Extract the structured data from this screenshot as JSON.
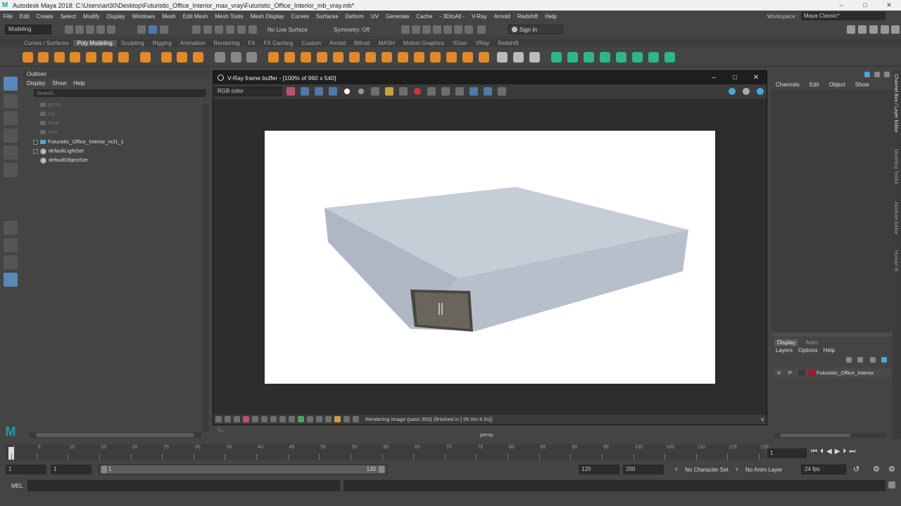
{
  "app": {
    "title": "Autodesk Maya 2018: C:\\Users\\art30\\Desktop\\Futuristic_Office_Interior_max_vray\\Futuristic_Office_Interior_mb_vray.mb*",
    "logo": "M"
  },
  "menu": [
    "File",
    "Edit",
    "Create",
    "Select",
    "Modify",
    "Display",
    "Windows",
    "Mesh",
    "Edit Mesh",
    "Mesh Tools",
    "Mesh Display",
    "Curves",
    "Surfaces",
    "Deform",
    "UV",
    "Generate",
    "Cache",
    "- 3DtoAll -",
    "V-Ray",
    "Arnold",
    "Redshift",
    "Help"
  ],
  "workspace": {
    "label": "Workspace :",
    "value": "Maya Classic*"
  },
  "statusline": {
    "mode": "Modeling",
    "live_surface": "No Live Surface",
    "symmetry": "Symmetry: Off",
    "sign_in": "Sign In"
  },
  "shelf_tabs": [
    "Curves / Surfaces",
    "Poly Modeling",
    "Sculpting",
    "Rigging",
    "Animation",
    "Rendering",
    "FX",
    "FX Caching",
    "Custom",
    "Arnold",
    "Bifrost",
    "MASH",
    "Motion Graphics",
    "XGen",
    "VRay",
    "Redshift"
  ],
  "shelf_active": "Poly Modeling",
  "outliner": {
    "title": "Outliner",
    "menu": [
      "Display",
      "Show",
      "Help"
    ],
    "search_placeholder": "Search...",
    "items": [
      {
        "label": "persp",
        "dim": true,
        "icon": "camera-icon"
      },
      {
        "label": "top",
        "dim": true,
        "icon": "camera-icon"
      },
      {
        "label": "front",
        "dim": true,
        "icon": "camera-icon"
      },
      {
        "label": "side",
        "dim": true,
        "icon": "camera-icon"
      },
      {
        "label": "Futuristic_Office_Interior_ncl1_1",
        "dim": false,
        "icon": "group-icon"
      },
      {
        "label": "defaultLightSet",
        "dim": false,
        "icon": "set-icon"
      },
      {
        "label": "defaultObjectSet",
        "dim": false,
        "icon": "set-icon"
      }
    ]
  },
  "vray": {
    "title": "V-Ray frame buffer - [100% of 960 x 540]",
    "channel": "RGB color",
    "status": "Rendering image (pass 353) (finished in [ 0h  0m  6.5s])",
    "viewport_label": "persp"
  },
  "channel_box": {
    "menu": [
      "Channels",
      "Edit",
      "Object",
      "Show"
    ],
    "layer_tabs": [
      "Display",
      "Anim"
    ],
    "layer_menu": [
      "Layers",
      "Options",
      "Help"
    ],
    "layer": {
      "v": "V",
      "p": "P",
      "name": "Futuristic_Office_Interior",
      "color": "#9b1c2e"
    }
  },
  "right_strip": [
    "Channel Box / Layer Editor",
    "Modeling Toolkit",
    "Attribute Editor",
    "Human IK"
  ],
  "timeline": {
    "ticks": [
      "1",
      "5",
      "10",
      "15",
      "20",
      "25",
      "30",
      "35",
      "40",
      "45",
      "50",
      "55",
      "60",
      "65",
      "70",
      "75",
      "80",
      "85",
      "90",
      "95",
      "100",
      "105",
      "110",
      "115",
      "120"
    ],
    "current_frame": "1"
  },
  "range": {
    "start": "1",
    "anim_start": "1",
    "slider_start": "1",
    "slider_end": "120",
    "end": "120",
    "anim_end": "200",
    "character_set": "No Character Set",
    "anim_layer": "No Anim Layer",
    "fps": "24 fps"
  },
  "mel": {
    "label": "MEL"
  }
}
